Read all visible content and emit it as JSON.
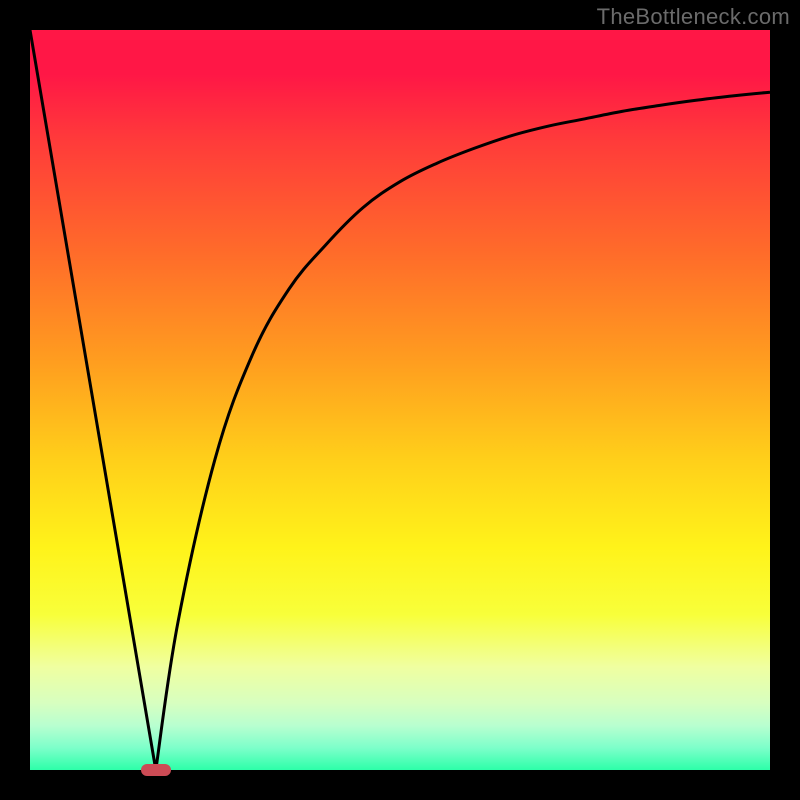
{
  "watermark": "TheBottleneck.com",
  "colors": {
    "curve": "#000000",
    "marker": "#cc4b55",
    "frame": "#000000"
  },
  "chart_data": {
    "type": "line",
    "title": "",
    "xlabel": "",
    "ylabel": "",
    "xlim": [
      0,
      100
    ],
    "ylim": [
      0,
      100
    ],
    "grid": false,
    "legend": false,
    "notes": "Bottleneck-style curve: value falls from 100 at x=0 to 0 at the optimum (x≈17), then rises asymptotically toward ~92 as x→100. Background is a vertical red→green gradient (high=red at top, low=green at bottom). A small rounded marker sits at the minimum.",
    "optimum_x": 17,
    "marker_value": 0,
    "series": [
      {
        "name": "left-branch",
        "x": [
          0,
          17
        ],
        "values": [
          100,
          0
        ]
      },
      {
        "name": "right-branch",
        "x": [
          17,
          20,
          25,
          30,
          35,
          40,
          45,
          50,
          55,
          60,
          65,
          70,
          75,
          80,
          85,
          90,
          95,
          100
        ],
        "values": [
          0,
          20,
          42,
          56,
          65,
          71,
          76,
          79.5,
          82,
          84,
          85.7,
          87,
          88,
          89,
          89.8,
          90.5,
          91.1,
          91.6
        ]
      }
    ]
  }
}
